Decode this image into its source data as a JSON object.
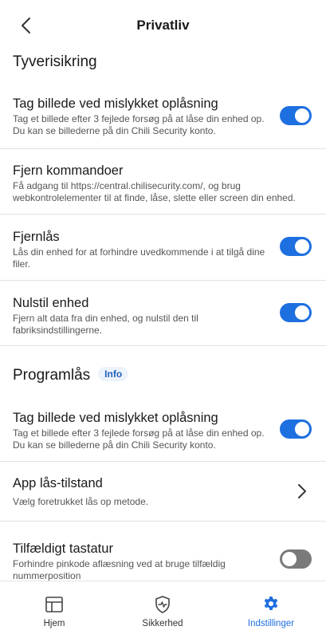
{
  "header": {
    "title": "Privatliv"
  },
  "sections": {
    "theft": {
      "title": "Tyverisikring"
    },
    "applock": {
      "title": "Programlås",
      "info": "Info"
    }
  },
  "rows": [
    {
      "title": "Tag billede ved mislykket oplåsning",
      "desc": "Tag et billede efter 3 fejlede forsøg på at låse din enhed op. Du kan se billederne på din Chili Security konto.",
      "toggle": "on"
    },
    {
      "title": "Fjern kommandoer",
      "desc": "Få adgang til https://central.chilisecurity.com/, og brug webkontrolelementer til at finde, låse, slette eller screen din enhed."
    },
    {
      "title": "Fjernlås",
      "desc": "Lås din enhed for at forhindre uvedkommende i at tilgå dine filer.",
      "toggle": "on"
    },
    {
      "title": "Nulstil enhed",
      "desc": "Fjern alt data fra din enhed, og nulstil den til fabriksindstillingerne.",
      "toggle": "on"
    },
    {
      "title": "Tag billede ved mislykket oplåsning",
      "desc": "Tag et billede efter 3 fejlede forsøg på at låse din enhed op. Du kan se billederne på din Chili Security konto.",
      "toggle": "on"
    },
    {
      "title": "App lås-tilstand",
      "desc": "Vælg foretrukket lås op metode."
    },
    {
      "title": "Tilfældigt tastatur",
      "desc": "Forhindre pinkode aflæsning ved at bruge tilfældig nummerposition",
      "toggle": "off"
    }
  ],
  "nav": [
    {
      "label": "Hjem",
      "icon": "home-icon"
    },
    {
      "label": "Sikkerhed",
      "icon": "shield-icon"
    },
    {
      "label": "Indstillinger",
      "icon": "gear-icon"
    }
  ],
  "colors": {
    "accent": "#1e6fe0",
    "toggle_off": "#7a7a7a",
    "divider": "#e2e2e2"
  }
}
